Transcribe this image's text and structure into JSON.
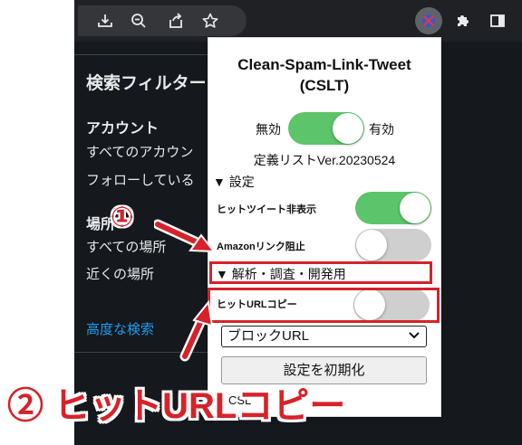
{
  "page": {
    "heading": "検索フィルター",
    "account_heading": "アカウント",
    "account_all": "すべてのアカウン",
    "account_following": "フォローしている",
    "location_heading": "場所",
    "location_all": "すべての場所",
    "location_near": "近くの場所",
    "advanced_search": "高度な検索"
  },
  "popup": {
    "title_line1": "Clean-Spam-Link-Tweet",
    "title_line2": "(CSLT)",
    "off_label": "無効",
    "on_label": "有効",
    "main_enabled": true,
    "def_list_version": "定義リストVer.20230524",
    "settings_summary": "▼ 設定",
    "hide_hit_tweets_label": "ヒットツイート非表示",
    "hide_hit_tweets_on": true,
    "block_amazon_label": "Amazonリンク阻止",
    "block_amazon_on": false,
    "analysis_summary": "▼ 解析・調査・開発用",
    "copy_hit_url_label": "ヒットURLコピー",
    "copy_hit_url_on": false,
    "select_value": "ブロックURL",
    "reset_button": "設定を初期化",
    "footer_partial": "CSL"
  },
  "annotations": {
    "marker1": "①",
    "marker2_label": "② ヒットURLコピー"
  },
  "colors": {
    "toggle_on": "#5cc46a",
    "toggle_off": "#cfcfcf",
    "annotation_red": "#d7222a",
    "chrome_dark": "#202124",
    "page_dark": "#15181c",
    "link_blue": "#1d9bf0"
  },
  "icons": [
    "install-icon",
    "zoom-icon",
    "share-icon",
    "star-icon",
    "cslt-extension-icon",
    "puzzle-extensions-icon",
    "sidepanel-icon"
  ]
}
